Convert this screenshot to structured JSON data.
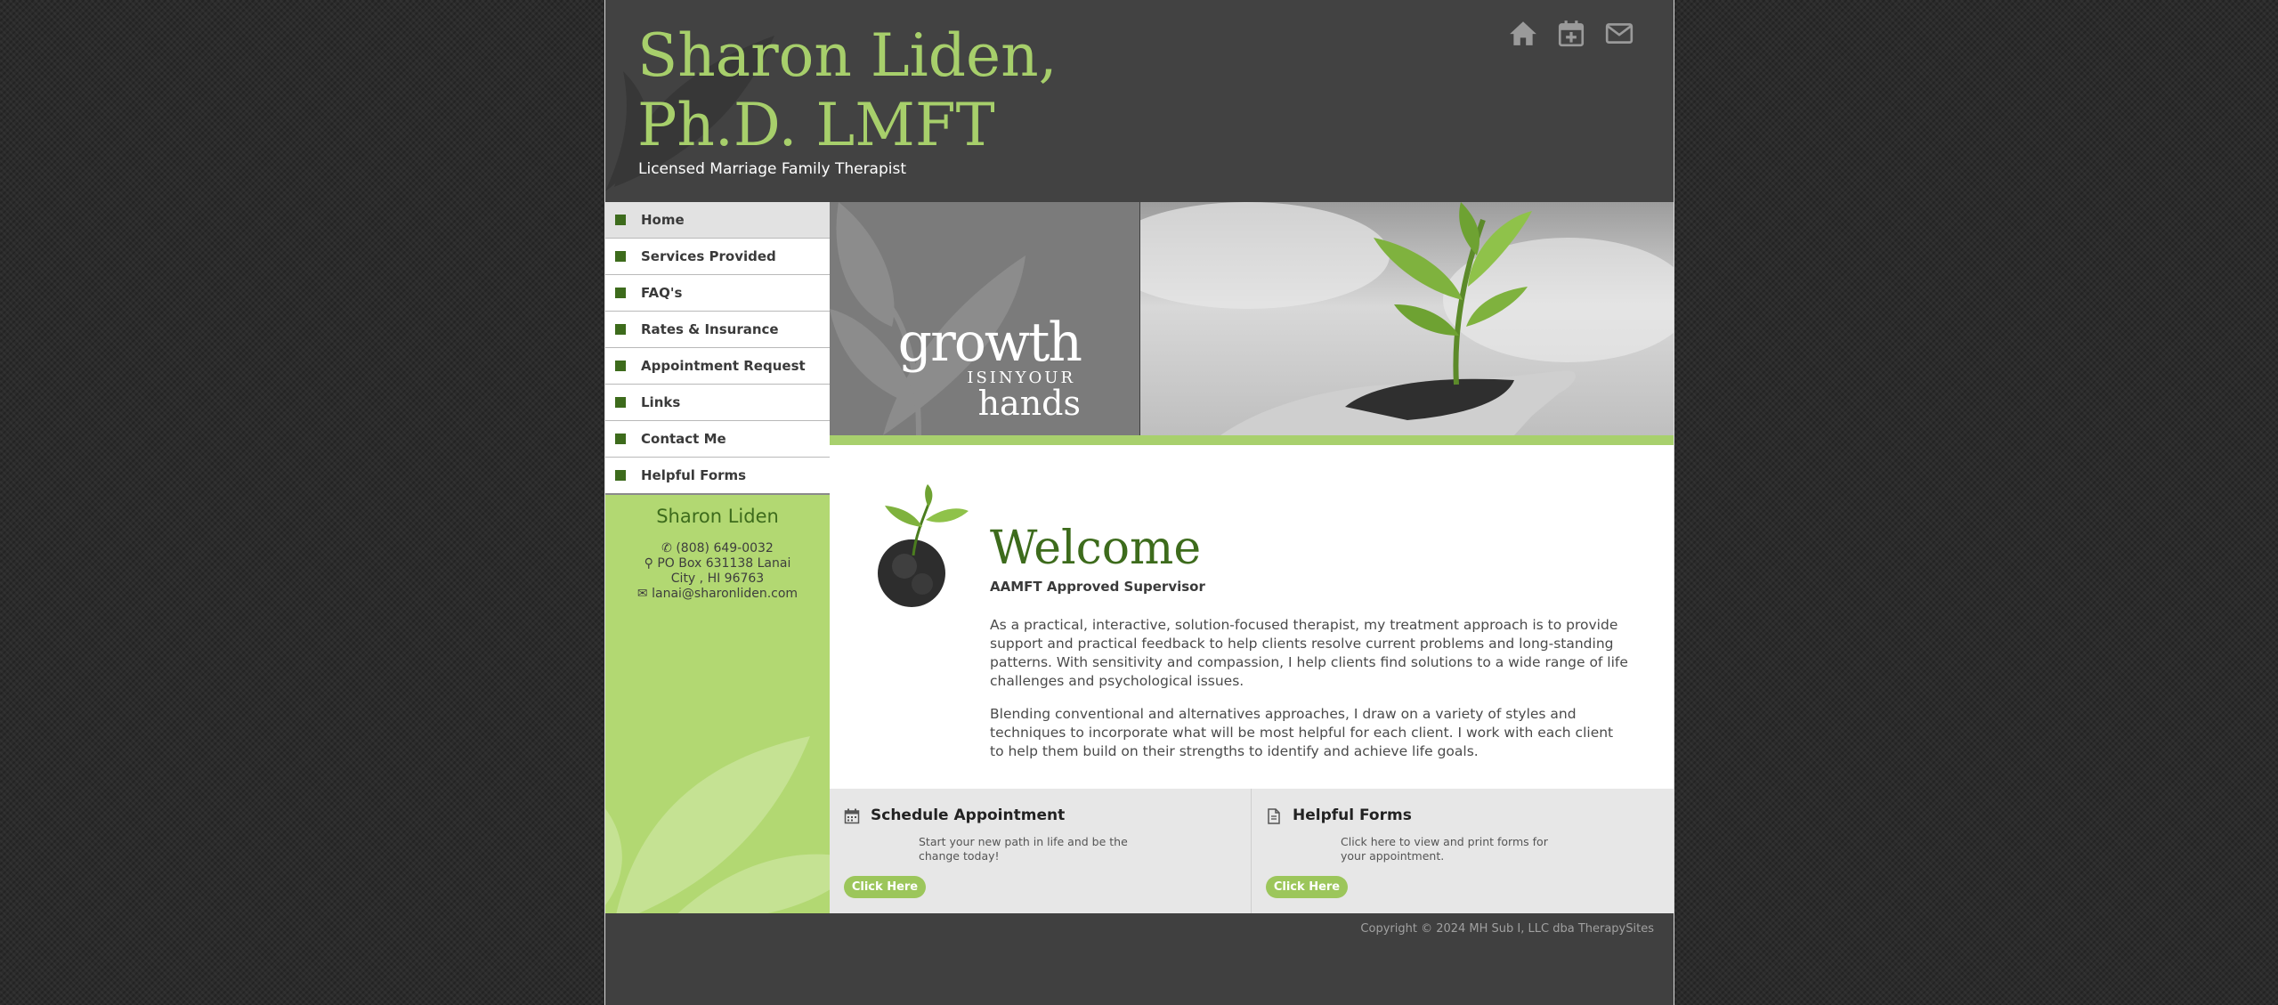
{
  "header": {
    "title_line1": "Sharon Liden,",
    "title_line2": "Ph.D. LMFT",
    "tagline": "Licensed Marriage Family Therapist",
    "icons": [
      "home-icon",
      "calendar-plus-icon",
      "envelope-icon"
    ]
  },
  "nav": {
    "items": [
      {
        "label": "Home",
        "active": true
      },
      {
        "label": "Services Provided"
      },
      {
        "label": "FAQ's"
      },
      {
        "label": "Rates & Insurance"
      },
      {
        "label": "Appointment Request"
      },
      {
        "label": "Links"
      },
      {
        "label": "Contact Me"
      },
      {
        "label": "Helpful Forms"
      }
    ]
  },
  "contact": {
    "name": "Sharon Liden",
    "phone": "(808) 649-0032",
    "address": "PO Box 631138 Lanai City , HI 96763",
    "email": "lanai@sharonliden.com"
  },
  "banner": {
    "line1": "growth",
    "line2": "ISINYOUR",
    "line3": "hands"
  },
  "main": {
    "heading": "Welcome",
    "subtitle": "AAMFT Approved Supervisor",
    "paragraph1": "As a practical, interactive, solution-focused therapist, my treatment approach is to provide support and practical feedback to help clients resolve current problems and long-standing patterns. With sensitivity and compassion, I help clients find solutions to a wide range of life challenges and psychological issues.",
    "paragraph2": "Blending conventional and alternatives approaches, I draw on a variety of styles and techniques to incorporate what will be most helpful for each client. I work with each client to help them build on their strengths to identify and achieve life goals."
  },
  "panels": {
    "left": {
      "title": "Schedule Appointment",
      "description": "Start your new path in life and be the change today!",
      "button": "Click Here"
    },
    "right": {
      "title": "Helpful Forms",
      "description": "Click here to view and print forms for your appointment.",
      "button": "Click Here"
    }
  },
  "footer": {
    "copyright": "Copyright © 2024 MH Sub I, LLC dba TherapySites"
  },
  "colors": {
    "accent_green": "#a7cf6b",
    "dark_green": "#3d6b1c",
    "header_bg": "#424242",
    "button_green": "#9cc65b"
  }
}
